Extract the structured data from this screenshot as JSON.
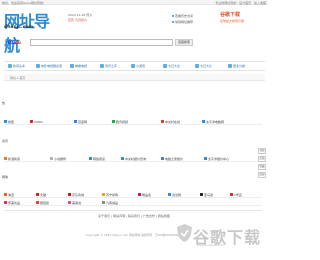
{
  "topbar": {
    "left": "你好，欢迎来到Guhe网址导航！",
    "right": "专业的网址导航 · 设为首页 · 加入收藏"
  },
  "logo": {
    "big": "网址导航",
    "domain": "dhanjc.com"
  },
  "date": {
    "line1": "2023-11-18 周六",
    "line2": "农历 九月初六"
  },
  "header_links": {
    "l1": "查看历史访问",
    "l2": "常用网址推荐"
  },
  "brand": {
    "b1": "谷歌下载",
    "b2": "全球最大搜索引擎"
  },
  "search": {
    "engine_a": "Bai",
    "engine_b": "du",
    "placeholder": "",
    "button": "百度搜索"
  },
  "nav": [
    {
      "label": "新闻头条"
    },
    {
      "label": "电影电视剧资源"
    },
    {
      "label": "看看电视"
    },
    {
      "label": "音乐之声"
    },
    {
      "label": "小游戏"
    },
    {
      "label": "今日大全"
    },
    {
      "label": "今日大片"
    },
    {
      "label": "更多分类"
    }
  ],
  "crumb": "网址 ▸ 首页",
  "sections": [
    {
      "title": "热",
      "rows": [
        [
          "搜狐",
          "CSDN",
          "百度网",
          "腾讯视频",
          "中关村在线",
          "太平洋电脑网"
        ]
      ]
    },
    {
      "title": "资讯",
      "rows": [
        [
          "新浪新闻",
          "小说推荐",
          "网络阅读",
          "中关村报价查询",
          "电脑之家报价",
          "太平洋报价中心"
        ]
      ]
    },
    {
      "title": "网购",
      "rows": [
        [
          "淘宝",
          "天猫",
          "京东商城",
          "苏宁易购",
          "唯品会",
          "当当网",
          "亚马逊",
          "1号店"
        ],
        [
          "聚美优品",
          "蘑菇街",
          "美丽说",
          "凡客诚品"
        ]
      ]
    }
  ],
  "side": [
    "顶部",
    "反馈",
    "收藏",
    "底部"
  ],
  "footer": {
    "links": "关于我们 | 网站声明 | 联系我们 | 广告合作 | 网站地图",
    "copy": "Copyright © 2023 dhanjc.com 网址导航 版权所有 · 京ICP备00000000号"
  },
  "watermark": {
    "text": "谷歌下载",
    "url": "www.gugexia.com"
  },
  "colors": {
    "accent": "#2a8bd8",
    "brand": "#e05a2b"
  }
}
